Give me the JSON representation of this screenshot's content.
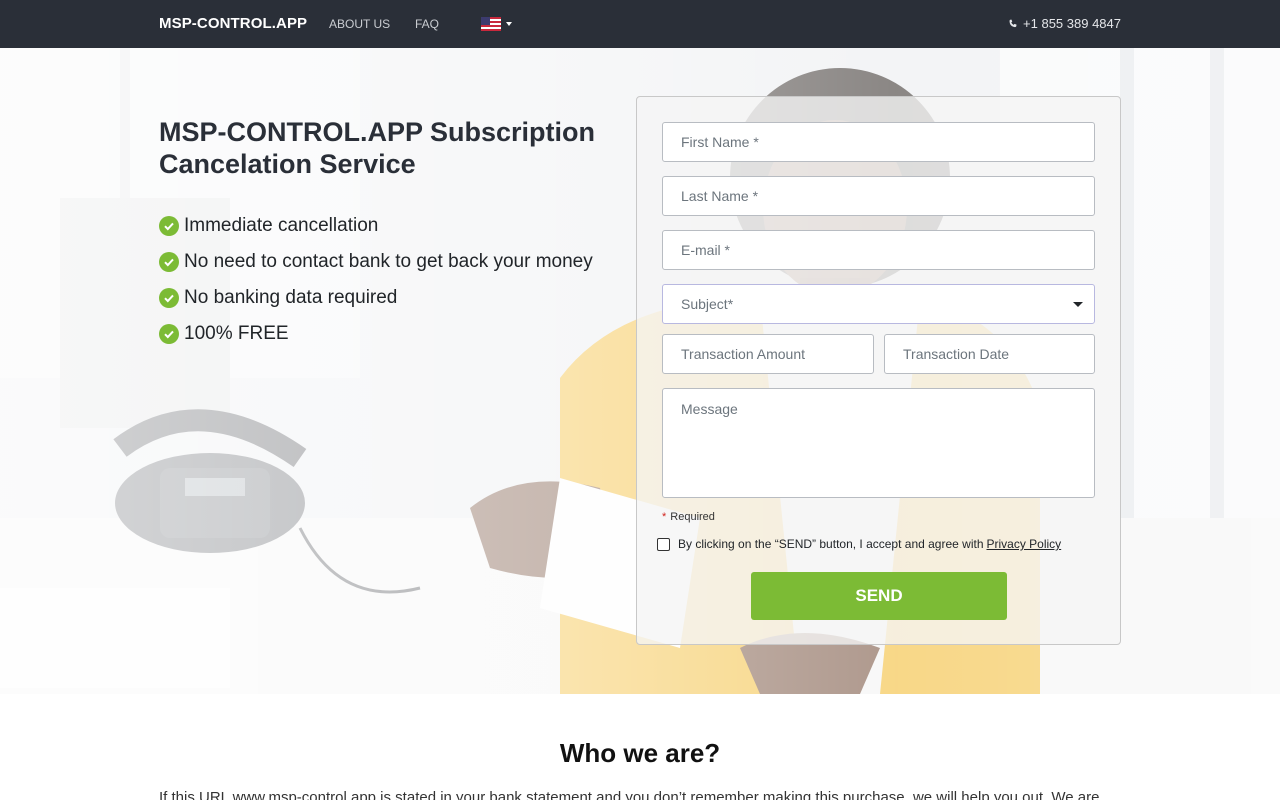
{
  "nav": {
    "brand": "MSP-CONTROL.APP",
    "about": "ABOUT US",
    "faq": "FAQ",
    "language_icon": "us-flag-icon",
    "phone": "+1 855 389 4847"
  },
  "hero": {
    "title": "MSP-CONTROL.APP Subscription Cancelation Service",
    "benefits": [
      "Immediate cancellation",
      "No need to contact bank to get back your money",
      "No banking data required",
      "100% FREE"
    ]
  },
  "form": {
    "first_name_placeholder": "First Name *",
    "last_name_placeholder": "Last Name *",
    "email_placeholder": "E-mail *",
    "subject_value": "Subject*",
    "amount_placeholder": "Transaction Amount",
    "date_placeholder": "Transaction Date",
    "message_placeholder": "Message",
    "required_star": "*",
    "required_label": "Required",
    "consent_text": "By clicking on the “SEND” button, I accept and agree with",
    "privacy_link": "Privacy Policy",
    "send_label": "SEND"
  },
  "about": {
    "title": "Who we are?",
    "text": "If this URL www.msp-control.app is stated in your bank statement and you don’t remember making this purchase, we will help you out. We are"
  },
  "colors": {
    "navbar": "#2a2f38",
    "accent_green": "#7cbb35"
  }
}
